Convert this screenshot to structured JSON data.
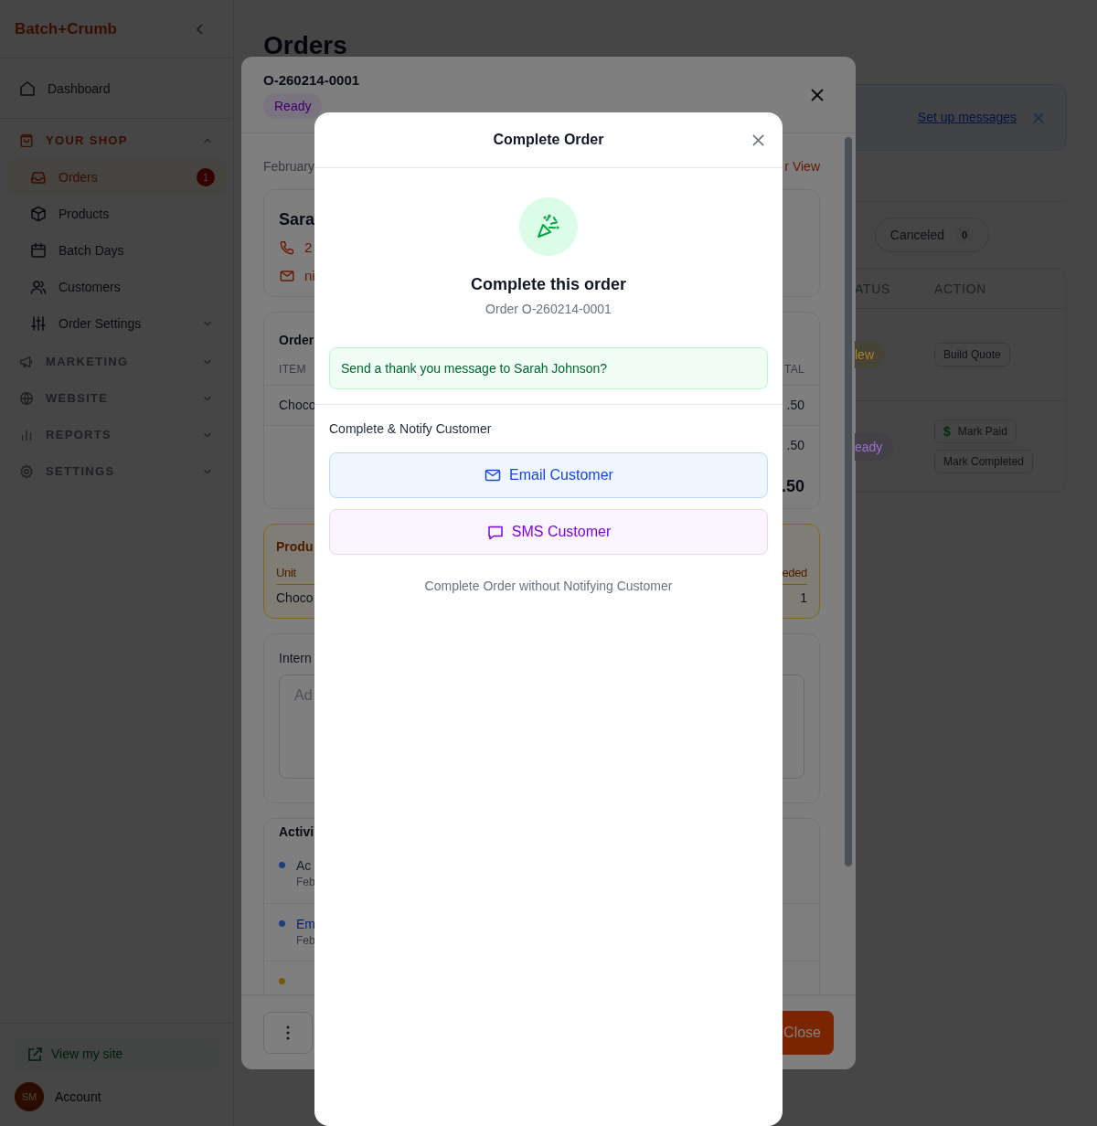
{
  "sidebar": {
    "logo": "Batch+Crumb",
    "dashboard": "Dashboard",
    "sections": [
      {
        "label": "YOUR SHOP",
        "expanded": true,
        "items": [
          {
            "label": "Orders",
            "kind": "link",
            "selected": true,
            "badge": "1"
          },
          {
            "label": "Products",
            "kind": "link",
            "selected": false
          },
          {
            "label": "Batch Days",
            "kind": "link",
            "selected": false
          },
          {
            "label": "Customers",
            "kind": "link",
            "selected": false
          },
          {
            "label": "Order Settings",
            "kind": "group",
            "selected": false
          }
        ]
      },
      {
        "label": "MARKETING",
        "expanded": false
      },
      {
        "label": "WEBSITE",
        "expanded": false
      },
      {
        "label": "REPORTS",
        "expanded": false
      },
      {
        "label": "SETTINGS",
        "expanded": false
      }
    ],
    "view_site": "View my site",
    "avatar": "SM",
    "account": "Account"
  },
  "main": {
    "title": "Orders",
    "banner_link": "Set up messages",
    "filters": [
      {
        "label": "Canceled",
        "count": "0"
      }
    ],
    "table": {
      "columns": [
        "ATUS",
        "ACTION"
      ],
      "rows": [
        {
          "status": "lew",
          "color": "#464337",
          "actions": [
            {
              "label": "Build Quote",
              "kind": "plain"
            }
          ]
        },
        {
          "status": "eady",
          "color": "#434046",
          "actions": [
            {
              "label": "Mark Paid",
              "kind": "paid",
              "symbol": "$"
            },
            {
              "label": "Mark Completed",
              "kind": "plain"
            }
          ]
        }
      ]
    }
  },
  "order": {
    "number": "O-260214-0001",
    "status": "Ready",
    "date": "February",
    "view_link": "r View",
    "customer": {
      "name": "Sara",
      "phone": "2",
      "email": "ni"
    },
    "items_card": {
      "title": "Order",
      "columns": [
        "ITEM",
        "TAL"
      ],
      "rows": [
        {
          "item": "Choco",
          "total": ".50"
        }
      ],
      "subtotal": ".50",
      "total": ".50"
    },
    "production": {
      "title": "Produ",
      "columns": [
        "Unit",
        "eded"
      ],
      "rows": [
        {
          "unit": "Choco",
          "needed": "1"
        }
      ]
    },
    "notes": {
      "title": "Intern",
      "placeholder": "Ad"
    },
    "activity": {
      "title": "Activi",
      "entries": [
        {
          "kind": "text",
          "title": "Ac",
          "time": "Feb",
          "color": "#1e417b"
        },
        {
          "kind": "link",
          "title": "Em",
          "time": "Feb",
          "color": "#1e417b"
        },
        {
          "color": "#755a04"
        }
      ]
    },
    "close": "Close"
  },
  "dialog": {
    "title": "Complete Order",
    "heading": "Complete this order",
    "subheading": "Order O-260214-0001",
    "prompt": "Send a thank you message to Sarah Johnson?",
    "section": "Complete & Notify Customer",
    "options": [
      {
        "label": "Email Customer",
        "kind": "email"
      },
      {
        "label": "SMS Customer",
        "kind": "sms"
      }
    ],
    "skip": "Complete Order without Notifying Customer"
  }
}
